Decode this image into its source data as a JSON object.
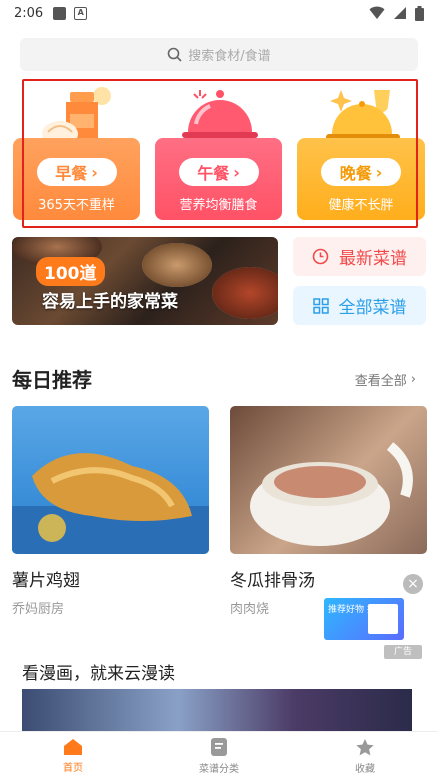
{
  "status": {
    "time": "2:06"
  },
  "search": {
    "placeholder": "搜索食材/食谱"
  },
  "meals": [
    {
      "label": "早餐",
      "sub": "365天不重样"
    },
    {
      "label": "午餐",
      "sub": "营养均衡膳食"
    },
    {
      "label": "晚餐",
      "sub": "健康不长胖"
    }
  ],
  "banner": {
    "badge": "100道",
    "title": "容易上手的家常菜"
  },
  "quick": {
    "latest": "最新菜谱",
    "all": "全部菜谱"
  },
  "daily": {
    "title": "每日推荐",
    "see_all": "查看全部",
    "cards": [
      {
        "title": "薯片鸡翅",
        "author": "乔妈厨房"
      },
      {
        "title": "冬瓜排骨汤",
        "author": "肉肉烧"
      }
    ]
  },
  "ad": {
    "close": "×",
    "tag": "广告",
    "img_text": "推荐好物 排行榜"
  },
  "comic": {
    "title": "看漫画，就来云漫读"
  },
  "tabs": [
    {
      "label": "首页"
    },
    {
      "label": "菜谱分类"
    },
    {
      "label": "收藏"
    }
  ],
  "colors": {
    "accent": "#ff7a1a",
    "breakfast": "#ff8a3c",
    "lunch": "#ff5266",
    "dinner": "#ffae1c",
    "highlight": "#e3221c"
  }
}
